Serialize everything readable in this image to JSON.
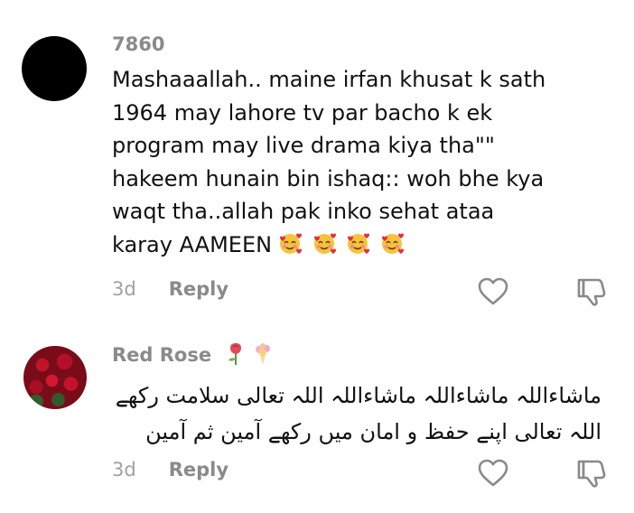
{
  "comments": [
    {
      "username": "7860",
      "text_lines": [
        "Mashaaallah.. maine irfan khusat k sath",
        "1964 may lahore tv par bacho k ek",
        "program may live drama kiya tha\"\"",
        "hakeem hunain bin ishaq:: woh bhe kya",
        "waqt tha..allah pak inko sehat ataa",
        "karay AAMEEN"
      ],
      "emoji": "smiling-face-with-hearts x4",
      "time": "3d",
      "reply_label": "Reply"
    },
    {
      "username": "Red Rose",
      "name_emoji": "rose and bouquet",
      "text_lines": [
        "ماشاءاللہ ماشاءاللہ ماشاءاللہ اللہ تعالی سلامت رکھے",
        "اللہ تعالی اپنے حفظ و امان میں رکھے آمین ثم آمین"
      ],
      "time": "3d",
      "reply_label": "Reply"
    }
  ],
  "icons": {
    "like": "heart-outline-icon",
    "dislike": "thumbs-down-outline-icon"
  },
  "colors": {
    "username": "#8a8a8a",
    "text": "#111111",
    "meta": "#a0a0a0",
    "icon": "#8a8a8a"
  }
}
